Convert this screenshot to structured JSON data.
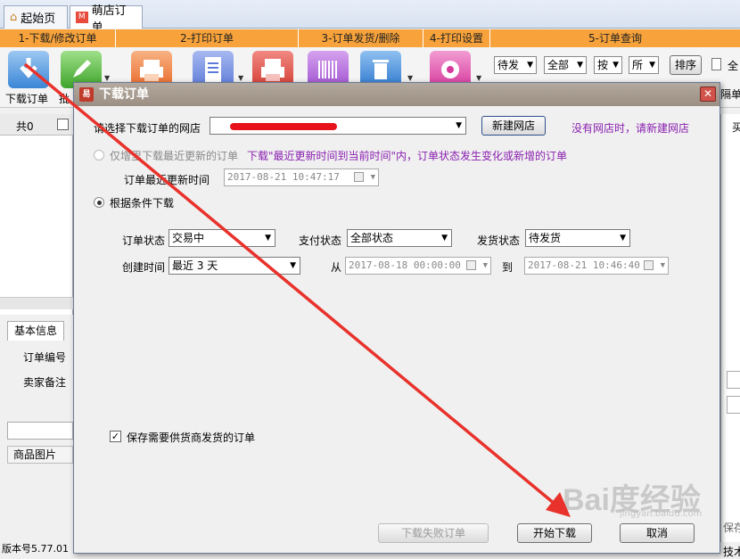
{
  "tabs": [
    {
      "label": "起始页"
    },
    {
      "label": "萌店订单"
    }
  ],
  "sections": [
    "1-下载/修改订单",
    "2-打印订单",
    "3-订单发货/删除",
    "4-打印设置",
    "5-订单查询"
  ],
  "toolbar": {
    "download_label": "下载订单",
    "batch_label": "批",
    "filters": [
      "待发",
      "全部",
      "按",
      "所"
    ],
    "sort_label": "排序",
    "all_label": "全",
    "cut_label": "隔单"
  },
  "left_panel": {
    "count_label": "共0",
    "tab_basic": "基本信息",
    "order_no": "订单编号",
    "seller_note": "卖家备注",
    "product_image": "商品图片",
    "version": "版本号5.77.01"
  },
  "right_edge": {
    "buy": "买",
    "save": "保存",
    "tech": "技术"
  },
  "dialog": {
    "title": "下载订单",
    "title_icon": "易",
    "store_label": "请选择下载订单的网店",
    "store_value": "",
    "new_store_button": "新建网店",
    "no_store_hint": "没有网店时，请新建网店",
    "option_recent_label": "仅增里下载最近更新的订单",
    "option_recent_hint": "下载\"最近更新时间到当前时间\"内，订单状态发生变化或新增的订单",
    "last_update_label": "订单最近更新时间",
    "last_update_value": "2017-08-21 10:47:17",
    "option_condition_label": "根据条件下载",
    "order_status_label": "订单状态",
    "order_status_value": "交易中",
    "pay_status_label": "支付状态",
    "pay_status_value": "全部状态",
    "ship_status_label": "发货状态",
    "ship_status_value": "待发货",
    "create_time_label": "创建时间",
    "create_time_value": "最近 3 天",
    "from_label": "从",
    "from_value": "2017-08-18 00:00:00",
    "to_label": "到",
    "to_value": "2017-08-21 10:46:40",
    "save_supplier_label": "保存需要供货商发货的订单",
    "failed_button": "下载失败订单",
    "start_button": "开始下载",
    "cancel_button": "取消"
  },
  "watermark": {
    "text": "Bai度经验",
    "sub": "jingyan.baidu.com"
  },
  "colors": {
    "section_bar": "#f7a23a",
    "title_bar": "#a89c91",
    "hint_purple": "#8a1fb0",
    "arrow": "#e8322b"
  }
}
